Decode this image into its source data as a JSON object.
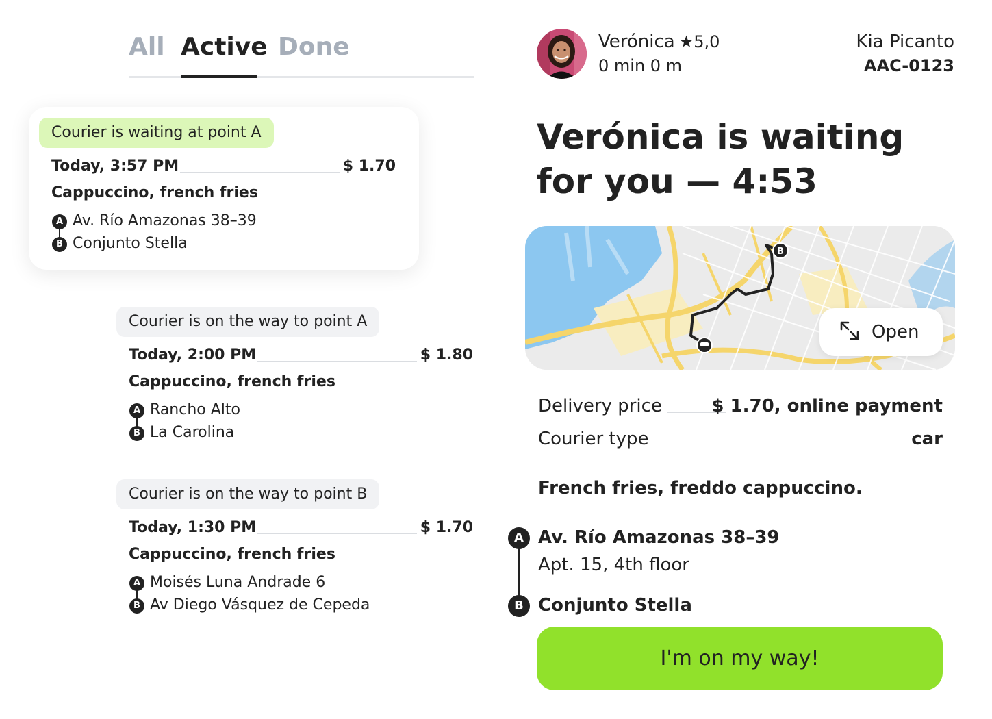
{
  "tabs": {
    "all": "All",
    "active": "Active",
    "done": "Done"
  },
  "orders": [
    {
      "status": "Courier is waiting at point A",
      "time": "Today, 3:57 PM",
      "price": "$ 1.70",
      "items": "Cappuccino, french fries",
      "point_a": "Av. Río Amazonas 38–39",
      "point_b": "Conjunto Stella"
    },
    {
      "status": "Courier is on the way to point A",
      "time": "Today, 2:00 PM",
      "price": "$ 1.80",
      "items": "Cappuccino, french fries",
      "point_a": "Rancho Alto",
      "point_b": "La Carolina"
    },
    {
      "status": "Courier is on the way to point B",
      "time": "Today, 1:30 PM",
      "price": "$ 1.70",
      "items": "Cappuccino, french fries",
      "point_a": "Moisés Luna Andrade 6",
      "point_b": "Av Diego Vásquez de Cepeda"
    }
  ],
  "markers": {
    "a": "A",
    "b": "B"
  },
  "courier": {
    "name": "Verónica",
    "rating": "5,0",
    "eta": "0 min 0 m",
    "car": "Kia Picanto",
    "plate": "AAC-0123"
  },
  "headline": {
    "line1": "Verónica is waiting",
    "line2": "for you — 4:53"
  },
  "map": {
    "open_label": "Open",
    "marker_b": "B"
  },
  "details": {
    "delivery_label": "Delivery price",
    "delivery_value": "$ 1.70, online payment",
    "courier_type_label": "Courier type",
    "courier_type_value": "car",
    "description": "French fries, freddo cappuccino."
  },
  "route": {
    "point_a": "Av. Río Amazonas 38–39",
    "point_a_sub": "Apt. 15, 4th floor",
    "point_b": "Conjunto Stella"
  },
  "cta": "I'm on my way!",
  "colors": {
    "accent_green": "#91e12b",
    "pill_green": "#dcf7b8",
    "pill_grey": "#f1f2f4",
    "tab_inactive": "#a6aeb9",
    "map_water": "#8cc7f0",
    "map_road": "#f5d56b"
  }
}
